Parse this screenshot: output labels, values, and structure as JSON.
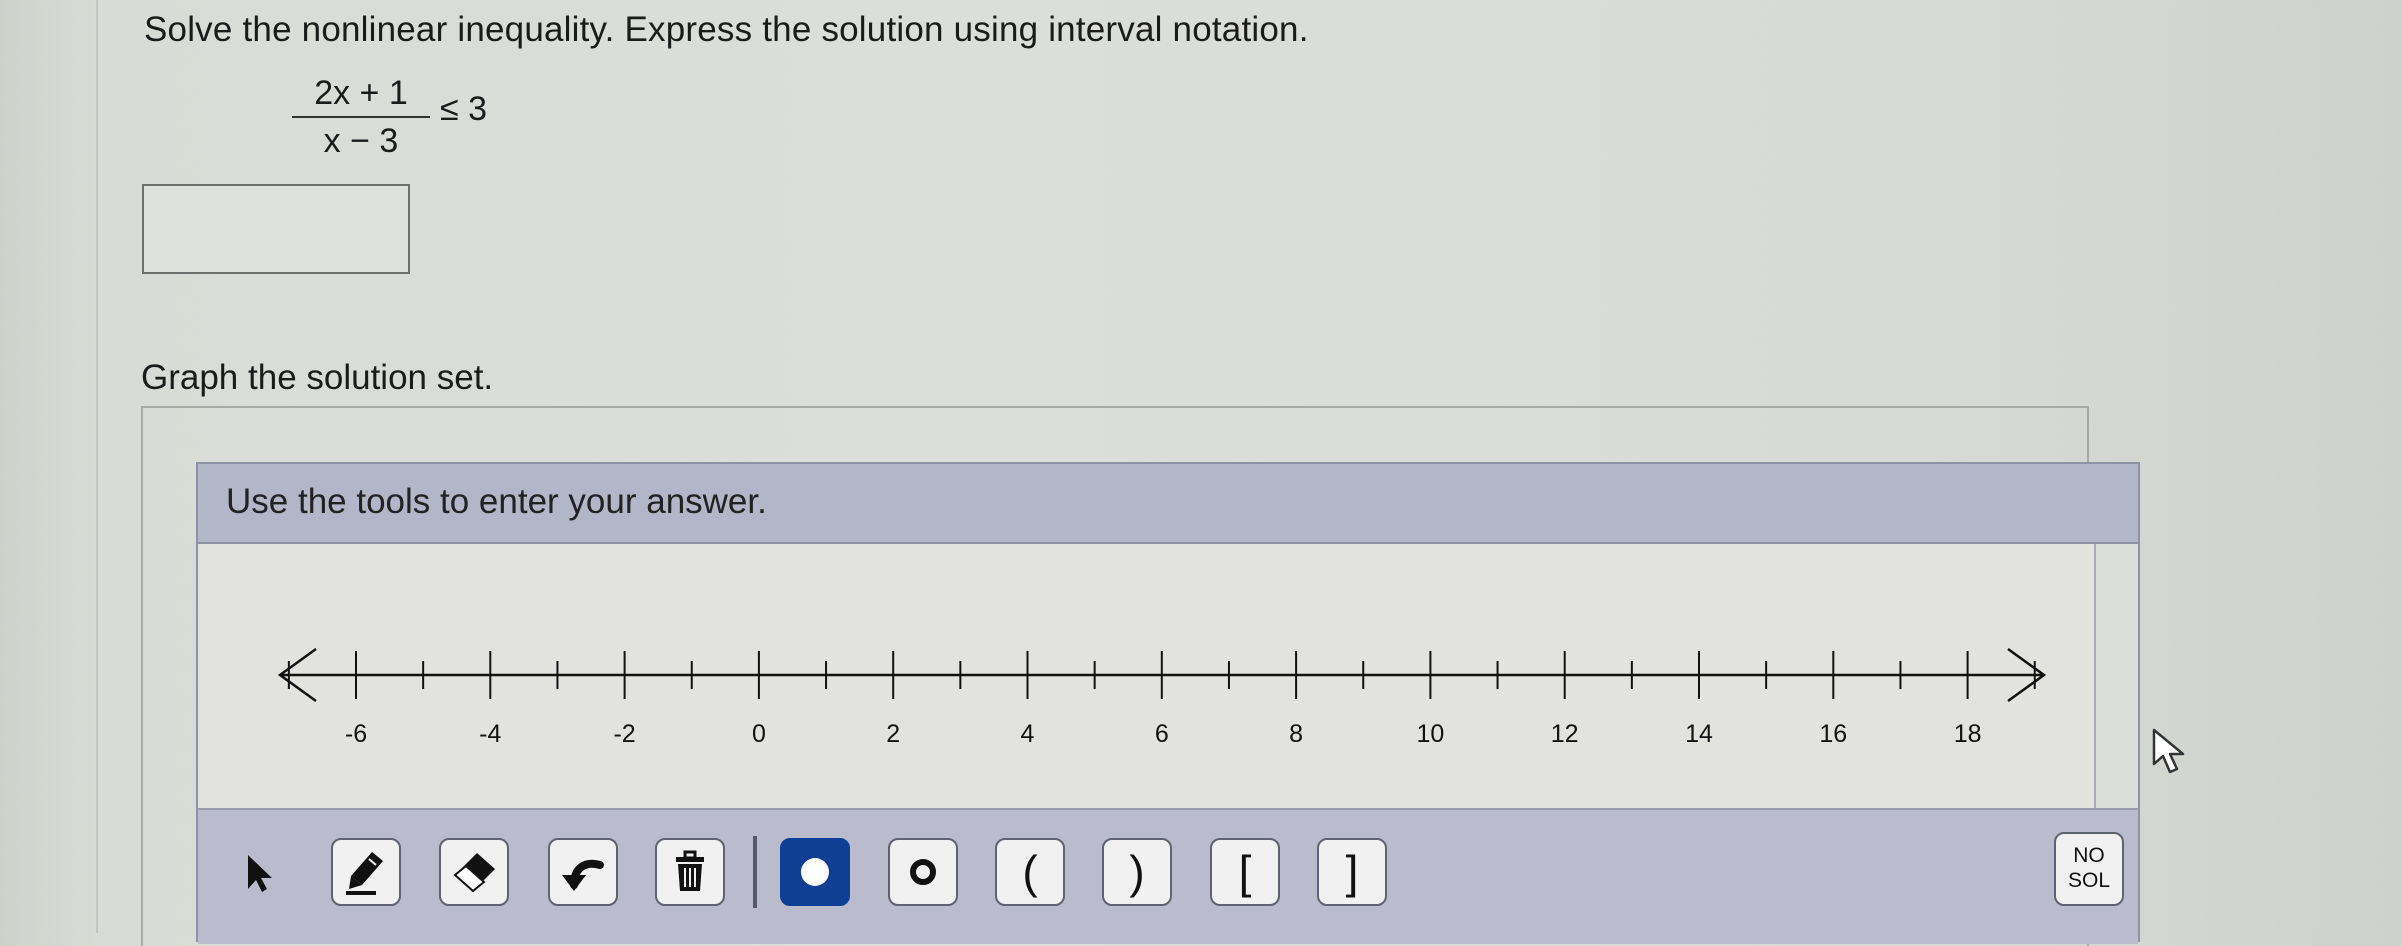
{
  "question": {
    "prompt": "Solve the nonlinear inequality. Express the solution using interval notation.",
    "numerator": "2x + 1",
    "denominator": "x − 3",
    "relation": "≤ 3"
  },
  "answer_input": {
    "value": ""
  },
  "graph": {
    "heading": "Graph the solution set.",
    "panel_header": "Use the tools to enter your answer.",
    "number_line": {
      "min": -7,
      "max": 19,
      "tick_step": 1,
      "labels": [
        "-6",
        "-4",
        "-2",
        "0",
        "2",
        "4",
        "6",
        "8",
        "10",
        "12",
        "14",
        "16",
        "18"
      ]
    }
  },
  "toolbar": {
    "tools": [
      {
        "name": "pointer-icon",
        "glyph": "arrow"
      },
      {
        "name": "pencil-icon",
        "glyph": "pencil"
      },
      {
        "name": "eraser-icon",
        "glyph": "eraser"
      },
      {
        "name": "undo-icon",
        "glyph": "undo"
      },
      {
        "name": "trash-icon",
        "glyph": "trash"
      },
      {
        "name": "closed-dot-icon",
        "glyph": "closed-dot",
        "active": true
      },
      {
        "name": "open-dot-icon",
        "glyph": "open-dot"
      },
      {
        "name": "left-paren-icon",
        "glyph": "("
      },
      {
        "name": "right-paren-icon",
        "glyph": ")"
      },
      {
        "name": "left-bracket-icon",
        "glyph": "["
      },
      {
        "name": "right-bracket-icon",
        "glyph": "]"
      }
    ],
    "left_paren": "(",
    "right_paren": ")",
    "left_bracket": "[",
    "right_bracket": "]",
    "no_solution_line1": "NO",
    "no_solution_line2": "SOL"
  },
  "colors": {
    "active_tool": "#0f3f95",
    "panel_header": "#b3b5c8",
    "toolbar": "#babccd"
  }
}
